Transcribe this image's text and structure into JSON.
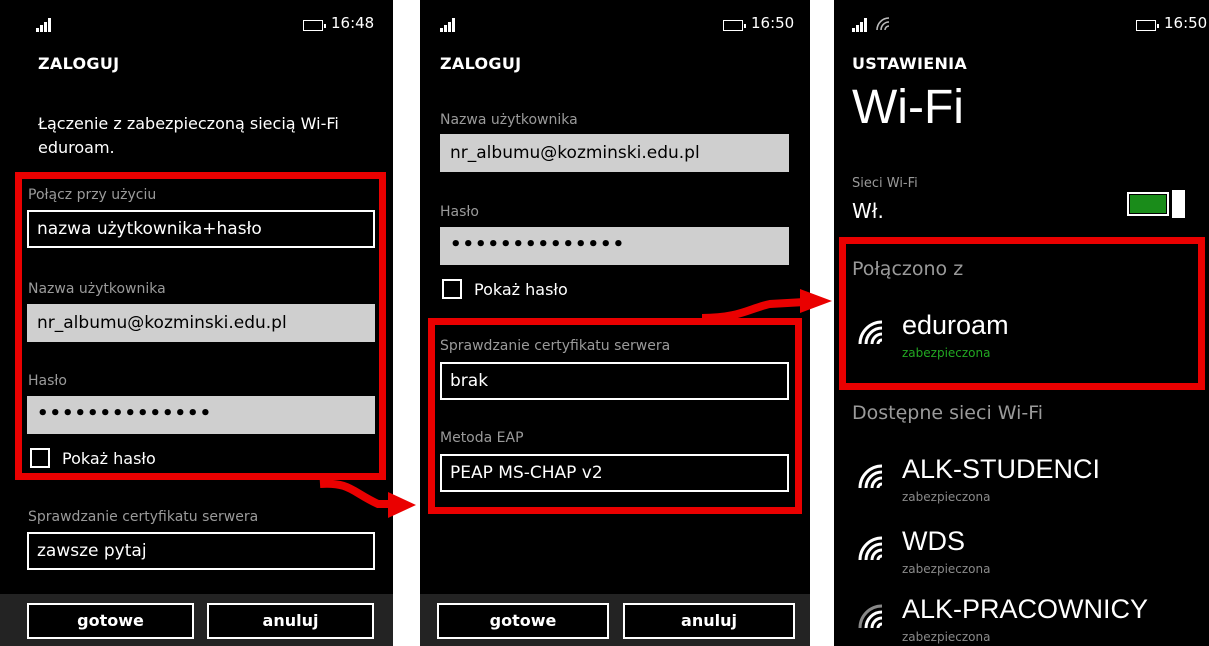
{
  "colors": {
    "accent_green": "#1a8c1a",
    "highlight_red": "#ea0000",
    "label_gray": "#9a9a9a"
  },
  "screen1": {
    "time": "16:48",
    "title": "ZALOGUJ",
    "intro": "Łączenie z zabezpieczoną siecią Wi-Fi eduroam.",
    "connect_with_label": "Połącz przy użyciu",
    "connect_with_value": "nazwa użytkownika+hasło",
    "username_label": "Nazwa użytkownika",
    "username_value": "nr_albumu@kozminski.edu.pl",
    "password_label": "Hasło",
    "password_value": "••••••••••••••",
    "show_password": "Pokaż hasło",
    "cert_label": "Sprawdzanie certyfikatu serwera",
    "cert_value": "zawsze pytaj",
    "done": "gotowe",
    "cancel": "anuluj"
  },
  "screen2": {
    "time": "16:50",
    "title": "ZALOGUJ",
    "username_label": "Nazwa użytkownika",
    "username_value": "nr_albumu@kozminski.edu.pl",
    "password_label": "Hasło",
    "password_value": "••••••••••••••",
    "show_password": "Pokaż hasło",
    "cert_label": "Sprawdzanie certyfikatu serwera",
    "cert_value": "brak",
    "eap_label": "Metoda EAP",
    "eap_value": "PEAP MS-CHAP v2",
    "done": "gotowe",
    "cancel": "anuluj"
  },
  "screen3": {
    "time": "16:50",
    "section": "USTAWIENIA",
    "title": "Wi-Fi",
    "wifi_label": "Sieci Wi-Fi",
    "wifi_state": "Wł.",
    "connected_header": "Połączono z",
    "connected": {
      "name": "eduroam",
      "status": "zabezpieczona"
    },
    "available_header": "Dostępne sieci Wi-Fi",
    "networks": [
      {
        "name": "ALK-STUDENCI",
        "status": "zabezpieczona"
      },
      {
        "name": "WDS",
        "status": "zabezpieczona"
      },
      {
        "name": "ALK-PRACOWNICY",
        "status": "zabezpieczona"
      }
    ]
  }
}
